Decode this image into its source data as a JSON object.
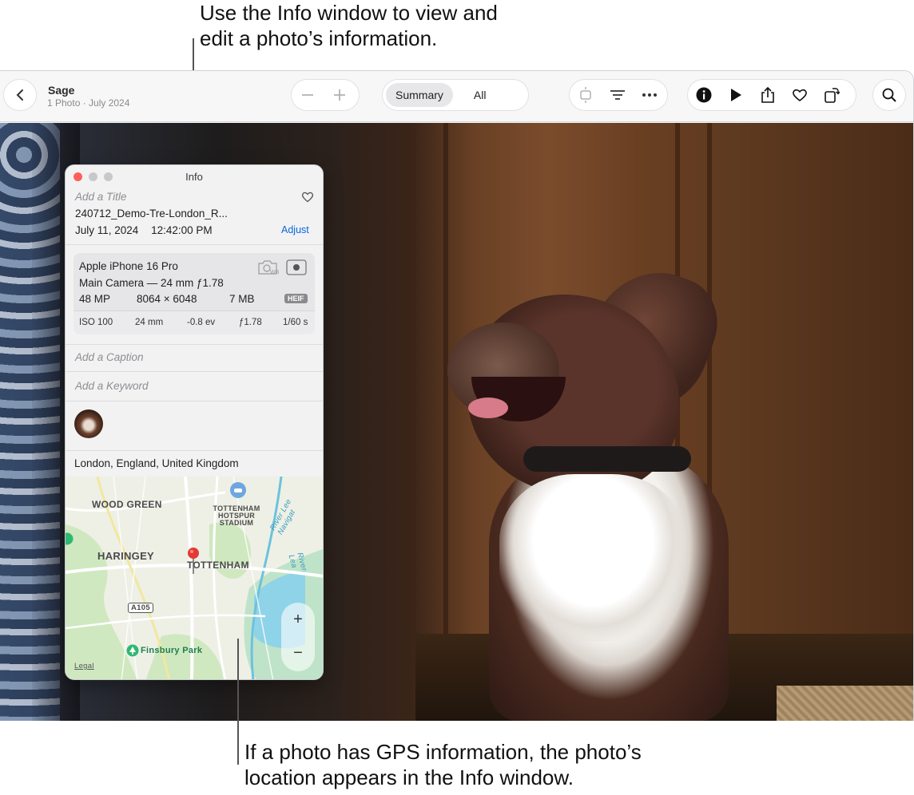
{
  "callouts": {
    "top_line1": "Use the Info window to view and",
    "top_line2": "edit a photo’s information.",
    "bottom_line1": "If a photo has GPS information, the photo’s",
    "bottom_line2": "location appears in the Info window."
  },
  "toolbar": {
    "album_title": "Sage",
    "album_subtitle": "1 Photo · July 2024",
    "segment_summary": "Summary",
    "segment_all": "All",
    "icons": [
      "back-icon",
      "zoom-out-icon",
      "zoom-in-icon",
      "aspect-icon",
      "filter-icon",
      "more-icon",
      "info-icon",
      "play-icon",
      "share-icon",
      "favorite-icon",
      "rotate-icon",
      "search-icon"
    ]
  },
  "info_window": {
    "title": "Info",
    "title_placeholder": "Add a Title",
    "filename": "240712_Demo-Tre-London_R...",
    "date": "July 11, 2024",
    "time": "12:42:00 PM",
    "adjust_label": "Adjust",
    "camera": {
      "device": "Apple iPhone 16 Pro",
      "lens": "Main Camera — 24 mm ƒ1.78",
      "megapixels": "48 MP",
      "dimensions": "8064 × 6048",
      "file_size": "7 MB",
      "format": "HEIF",
      "iso": "ISO 100",
      "focal_length": "24 mm",
      "exposure": "-0.8 ev",
      "aperture": "ƒ1.78",
      "shutter": "1/60 s"
    },
    "caption_placeholder": "Add a Caption",
    "keyword_placeholder": "Add a Keyword",
    "location": "London, England, United Kingdom",
    "map": {
      "labels": {
        "wood_green": "WOOD GREEN",
        "tottenham_hotspur_1": "TOTTENHAM",
        "tottenham_hotspur_2": "HOTSPUR",
        "tottenham_hotspur_3": "STADIUM",
        "haringey": "HARINGEY",
        "tottenham": "TOTTENHAM",
        "road": "A105",
        "park": "Finsbury Park",
        "river1": "River Lee Navigat",
        "river2": "River Lea",
        "legal": "Legal"
      },
      "zoom_in": "+",
      "zoom_out": "−"
    }
  },
  "colors": {
    "accent_blue": "#0a66d8",
    "close": "#ff5f57",
    "inactive_dot": "#c8c8cc",
    "pin": "#e53935",
    "park_green": "#2eb872"
  }
}
